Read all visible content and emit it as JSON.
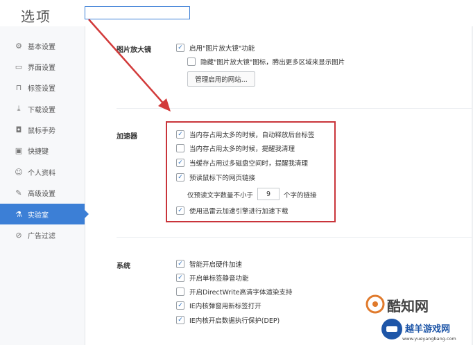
{
  "window": {
    "title": "选项"
  },
  "sidebar": {
    "items": [
      {
        "label": "基本设置",
        "icon": "gear-icon",
        "active": false
      },
      {
        "label": "界面设置",
        "icon": "window-icon",
        "active": false
      },
      {
        "label": "标签设置",
        "icon": "tab-icon",
        "active": false
      },
      {
        "label": "下载设置",
        "icon": "download-icon",
        "active": false
      },
      {
        "label": "鼠标手势",
        "icon": "mouse-icon",
        "active": false
      },
      {
        "label": "快捷键",
        "icon": "keyboard-icon",
        "active": false
      },
      {
        "label": "个人资料",
        "icon": "user-icon",
        "active": false
      },
      {
        "label": "高级设置",
        "icon": "wrench-icon",
        "active": false
      },
      {
        "label": "实验室",
        "icon": "flask-icon",
        "active": true
      },
      {
        "label": "广告过滤",
        "icon": "block-icon",
        "active": false
      }
    ]
  },
  "magnifier": {
    "label": "图片放大镜",
    "enable": {
      "label": "启用\"图片放大镜\"功能",
      "checked": true
    },
    "hide_icon": {
      "label": "隐藏\"图片放大镜\"图标，腾出更多区域来显示图片",
      "checked": false
    },
    "manage_button": "管理启用的网站..."
  },
  "accelerator": {
    "label": "加速器",
    "options": [
      {
        "label": "当内存占用太多的时候，自动释放后台标签",
        "checked": true
      },
      {
        "label": "当内存占用太多的时候，提醒我清理",
        "checked": false
      },
      {
        "label": "当缓存占用过多磁盘空间时，提醒我清理",
        "checked": true
      },
      {
        "label": "预读鼠标下的网页链接",
        "checked": true
      }
    ],
    "preload_prefix": "仅预读文字数量不小于",
    "preload_value": "9",
    "preload_suffix": "个字的链接",
    "xunlei": {
      "label": "使用迅雷云加速引擎进行加速下载",
      "checked": true
    }
  },
  "system": {
    "label": "系统",
    "options": [
      {
        "label": "智能开启硬件加速",
        "checked": true
      },
      {
        "label": "开启单标签静音功能",
        "checked": true
      },
      {
        "label": "开启DirectWrite高清字体渲染支持",
        "checked": false
      },
      {
        "label": "IE内核弹窗用新标签打开",
        "checked": true
      },
      {
        "label": "IE内核开启数据执行保护(DEP)",
        "checked": true
      }
    ]
  },
  "watermark": {
    "line1": "酷知网",
    "line2": "越羊游戏网",
    "line3": "www.yueyangbang.com"
  },
  "colors": {
    "accent": "#3c7fd6",
    "annotation": "#c9343a"
  }
}
